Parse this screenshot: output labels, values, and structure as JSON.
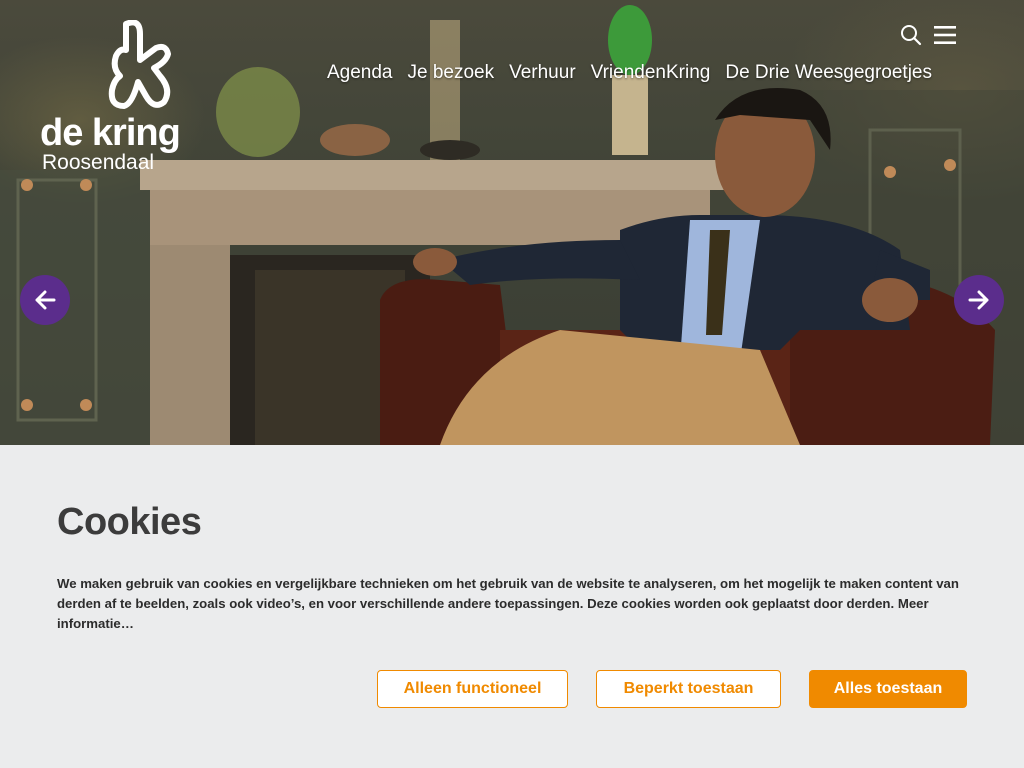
{
  "brand": {
    "logo_word": "de kring",
    "logo_city": "Roosendaal"
  },
  "nav": {
    "items": [
      "Agenda",
      "Je bezoek",
      "Verhuur",
      "VriendenKring",
      "De Drie Weesgegroetjes"
    ],
    "search_icon": "search-icon",
    "menu_icon": "hamburger-menu-icon"
  },
  "slider": {
    "prev_icon": "arrow-left-icon",
    "next_icon": "arrow-right-icon"
  },
  "cookie": {
    "title": "Cookies",
    "text": "We maken gebruik van cookies en vergelijkbare technieken om het gebruik van de website te analyseren, om het mogelijk te maken content van derden af te beelden, zoals ook video’s, en voor verschillende andere toepassingen. Deze cookies worden ook geplaatst door derden.",
    "more_link": "Meer informatie…",
    "buttons": {
      "functional": "Alleen functioneel",
      "limited": "Beperkt toestaan",
      "all": "Alles toestaan"
    }
  },
  "colors": {
    "accent_orange": "#f08a00",
    "arrow_purple": "#5b2d8c",
    "panel_bg": "#ebeced"
  }
}
